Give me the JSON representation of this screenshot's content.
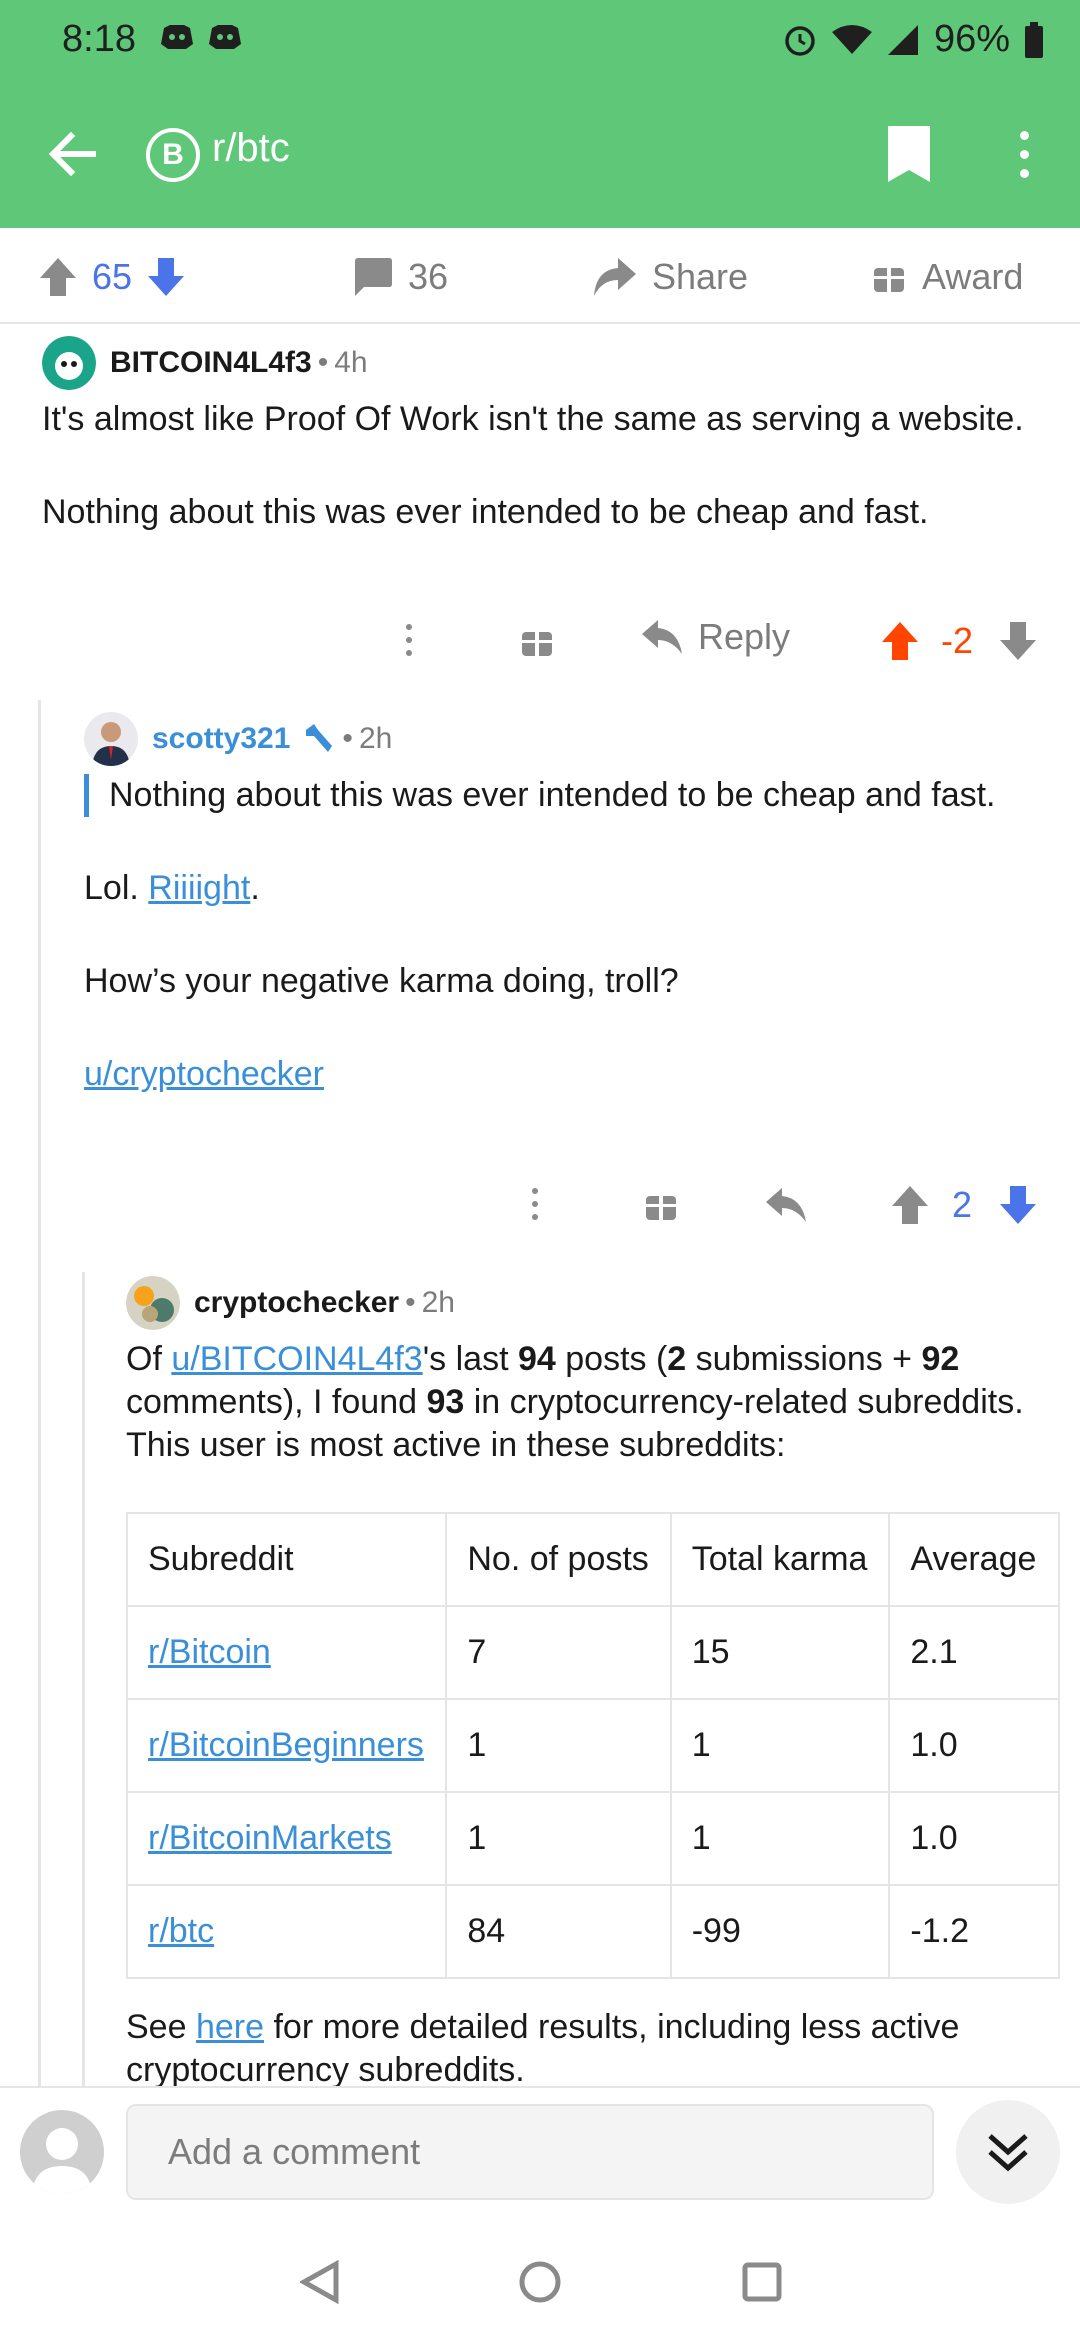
{
  "status": {
    "time": "8:18",
    "battery": "96%"
  },
  "header": {
    "subreddit": "r/btc",
    "subreddit_icon_letter": "B"
  },
  "post_actions": {
    "score": "65",
    "comments": "36",
    "share_label": "Share",
    "award_label": "Award"
  },
  "comments": [
    {
      "author": "BITCOIN4L4f3",
      "age": "4h",
      "body": [
        "It's almost like Proof Of Work isn't the same as serving a website.",
        "Nothing about this was ever intended to be cheap and fast."
      ],
      "reply_label": "Reply",
      "score": "-2"
    },
    {
      "author": "scotty321",
      "age": "2h",
      "quote": "Nothing about this was ever intended to be cheap and fast.",
      "lol_text": "Lol.",
      "riiiight_link": "Riiiight",
      "period": ".",
      "line2": "How’s your negative karma doing, troll?",
      "user_link": "u/cryptochecker",
      "score": "2"
    },
    {
      "author": "cryptochecker",
      "age": "2h",
      "intro": {
        "of": "Of ",
        "user_link": "u/BITCOIN4L4f3",
        "last": "'s last ",
        "posts_count": "94",
        "posts": " posts (",
        "submissions_count": "2",
        "submissions": " submissions + ",
        "comments_count": "92",
        "comments_text": " comments), I found ",
        "crypto_count": "93",
        "rest": " in cryptocurrency-related subreddits. This user is most active in these subreddits:"
      },
      "table": {
        "headers": [
          "Subreddit",
          "No. of posts",
          "Total karma",
          "Average"
        ],
        "rows": [
          [
            "r/Bitcoin",
            "7",
            "15",
            "2.1"
          ],
          [
            "r/BitcoinBeginners",
            "1",
            "1",
            "1.0"
          ],
          [
            "r/BitcoinMarkets",
            "1",
            "1",
            "1.0"
          ],
          [
            "r/btc",
            "84",
            "-99",
            "-1.2"
          ]
        ]
      },
      "footer": {
        "see": "See ",
        "here": "here",
        "rest": " for more detailed results, including less active cryptocurrency subreddits."
      }
    }
  ],
  "composer": {
    "placeholder": "Add a comment"
  },
  "colors": {
    "header_green": "#5fc878",
    "upvote_orange": "#ff4500",
    "vote_blue": "#4a74e8",
    "link_blue": "#3a8fd8"
  }
}
